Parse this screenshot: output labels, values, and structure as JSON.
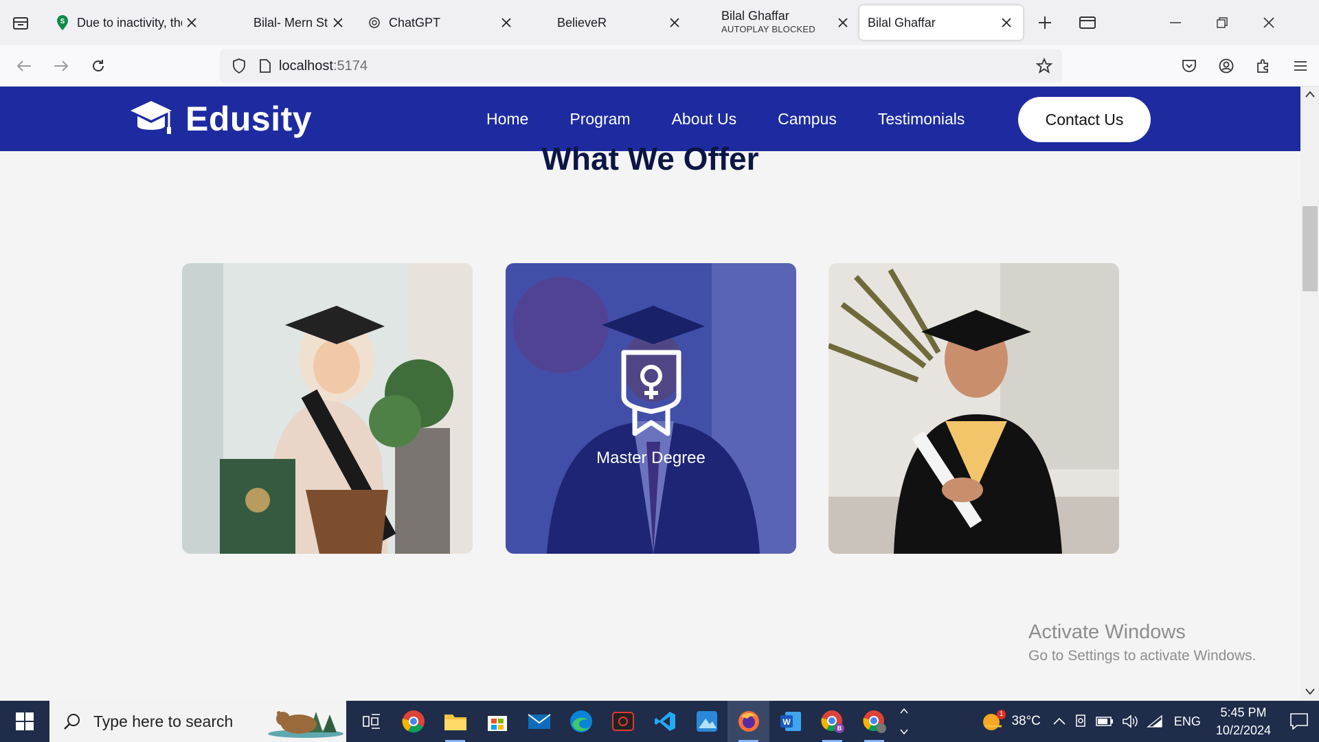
{
  "browser": {
    "tabs": [
      {
        "label": "Due to inactivity, the"
      },
      {
        "label": "Bilal- Mern Stack - CV.p"
      },
      {
        "label": "ChatGPT"
      },
      {
        "label": "BelieveR"
      },
      {
        "label": "Bilal Ghaffar",
        "sublabel": "AUTOPLAY BLOCKED"
      },
      {
        "label": "Bilal Ghaffar"
      }
    ],
    "url_host": "localhost",
    "url_port": ":5174"
  },
  "site": {
    "logo_text": "Edusity",
    "menu": [
      "Home",
      "Program",
      "About Us",
      "Campus",
      "Testimonials"
    ],
    "contact_label": "Contact Us",
    "section_title": "What We Offer",
    "card_overlay_label": "Master Degree"
  },
  "watermark": {
    "line1": "Activate Windows",
    "line2": "Go to Settings to activate Windows."
  },
  "taskbar": {
    "search_placeholder": "Type here to search",
    "temperature": "38°C",
    "weather_badge": "1",
    "language": "ENG",
    "time": "5:45 PM",
    "date": "10/2/2024"
  },
  "colors": {
    "brand": "#1e2ba0",
    "heading": "#0d1546",
    "taskbar": "#1f2c4a"
  }
}
